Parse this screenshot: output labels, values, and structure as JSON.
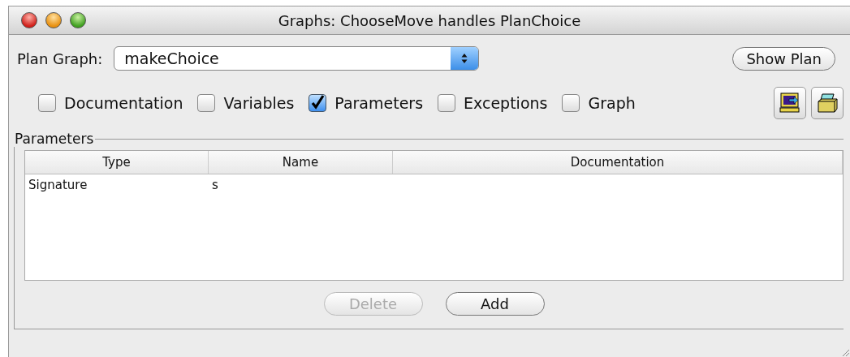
{
  "window": {
    "title": "Graphs: ChooseMove handles PlanChoice"
  },
  "plan_graph": {
    "label": "Plan Graph:",
    "value": "makeChoice"
  },
  "show_plan_button": {
    "label": "Show Plan",
    "disabled": false
  },
  "checkboxes": [
    {
      "label": "Documentation",
      "checked": false
    },
    {
      "label": "Variables",
      "checked": false
    },
    {
      "label": "Parameters",
      "checked": true
    },
    {
      "label": "Exceptions",
      "checked": false
    },
    {
      "label": "Graph",
      "checked": false
    }
  ],
  "parameters": {
    "title": "Parameters",
    "columns": [
      "Type",
      "Name",
      "Documentation"
    ],
    "rows": [
      [
        "Signature",
        "s",
        ""
      ]
    ]
  },
  "buttons": [
    {
      "label": "Delete",
      "disabled": true
    },
    {
      "label": "Add",
      "disabled": false
    }
  ]
}
